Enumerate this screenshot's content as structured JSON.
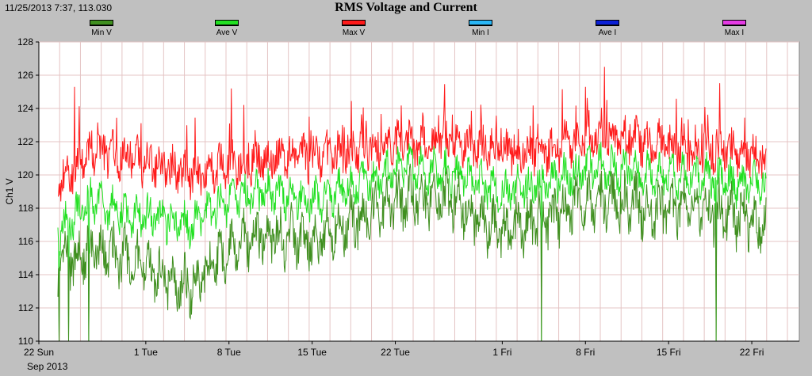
{
  "readout": "11/25/2013 7:37, 113.030",
  "colors": {
    "plot_bg": "#ffffff",
    "panel_bg": "#c0c0c0",
    "grid": "#e4c4c4",
    "min_v": "#3f8f1f",
    "ave_v": "#22e022",
    "max_v": "#ff1a1a",
    "min_i": "#29b6f6",
    "ave_i": "#0a1fd6",
    "max_i": "#e53be5"
  },
  "chart_data": {
    "type": "line",
    "title": "RMS Voltage and Current",
    "ylabel": "Ch1 V",
    "xlabel": "",
    "ylim": [
      110,
      128
    ],
    "yticks": [
      110,
      112,
      114,
      116,
      118,
      120,
      122,
      124,
      126,
      128
    ],
    "x_start_label": "Sep 2013",
    "xticks": [
      {
        "day": 0,
        "label": "22 Sun"
      },
      {
        "day": 9,
        "label": "1 Tue"
      },
      {
        "day": 16,
        "label": "8 Tue"
      },
      {
        "day": 23,
        "label": "15 Tue"
      },
      {
        "day": 30,
        "label": "22 Tue"
      },
      {
        "day": 39,
        "label": "1 Fri"
      },
      {
        "day": 46,
        "label": "8 Fri"
      },
      {
        "day": 53,
        "label": "15 Fri"
      },
      {
        "day": 60,
        "label": "22 Fri"
      }
    ],
    "xlim": [
      0,
      64
    ],
    "grid": true,
    "legend_position": "top",
    "series": [
      {
        "name": "Min V",
        "color_key": "min_v"
      },
      {
        "name": "Ave V",
        "color_key": "ave_v"
      },
      {
        "name": "Max V",
        "color_key": "max_v"
      },
      {
        "name": "Min I",
        "color_key": "min_i"
      },
      {
        "name": "Ave I",
        "color_key": "ave_i"
      },
      {
        "name": "Max I",
        "color_key": "max_i"
      }
    ],
    "data_start_day": 1.6,
    "data_end_day": 61.2,
    "envelope": [
      {
        "day": 1.6,
        "min": 114.5,
        "ave": 116.5,
        "max": 119.5
      },
      {
        "day": 4.5,
        "min": 115.5,
        "ave": 118.5,
        "max": 121.5
      },
      {
        "day": 7.5,
        "min": 115.0,
        "ave": 117.5,
        "max": 121.0
      },
      {
        "day": 10.0,
        "min": 114.0,
        "ave": 117.5,
        "max": 120.5
      },
      {
        "day": 13.0,
        "min": 113.5,
        "ave": 117.0,
        "max": 120.0
      },
      {
        "day": 16.0,
        "min": 115.5,
        "ave": 118.5,
        "max": 120.5
      },
      {
        "day": 19.0,
        "min": 116.5,
        "ave": 119.0,
        "max": 121.0
      },
      {
        "day": 23.0,
        "min": 116.0,
        "ave": 118.5,
        "max": 121.0
      },
      {
        "day": 27.0,
        "min": 117.5,
        "ave": 119.5,
        "max": 121.5
      },
      {
        "day": 31.0,
        "min": 118.5,
        "ave": 120.5,
        "max": 122.0
      },
      {
        "day": 35.0,
        "min": 118.5,
        "ave": 120.0,
        "max": 122.0
      },
      {
        "day": 39.0,
        "min": 116.5,
        "ave": 119.0,
        "max": 121.5
      },
      {
        "day": 43.0,
        "min": 117.5,
        "ave": 119.5,
        "max": 121.5
      },
      {
        "day": 47.0,
        "min": 118.5,
        "ave": 120.5,
        "max": 122.5
      },
      {
        "day": 51.0,
        "min": 118.0,
        "ave": 120.0,
        "max": 122.0
      },
      {
        "day": 55.0,
        "min": 118.0,
        "ave": 120.0,
        "max": 121.5
      },
      {
        "day": 58.5,
        "min": 117.5,
        "ave": 119.5,
        "max": 121.5
      },
      {
        "day": 61.2,
        "min": 117.0,
        "ave": 119.5,
        "max": 121.0
      }
    ],
    "notable_peaks": [
      {
        "day": 3.0,
        "max": 125.3
      },
      {
        "day": 16.2,
        "max": 125.2
      },
      {
        "day": 47.6,
        "max": 126.5
      },
      {
        "day": 46.0,
        "max": 125.3
      }
    ],
    "notable_drops": [
      {
        "day": 1.7,
        "min": 110.0
      },
      {
        "day": 2.5,
        "min": 110.0
      },
      {
        "day": 4.2,
        "min": 110.0
      },
      {
        "day": 42.3,
        "min": 110.0
      },
      {
        "day": 57.0,
        "min": 110.0
      }
    ]
  }
}
